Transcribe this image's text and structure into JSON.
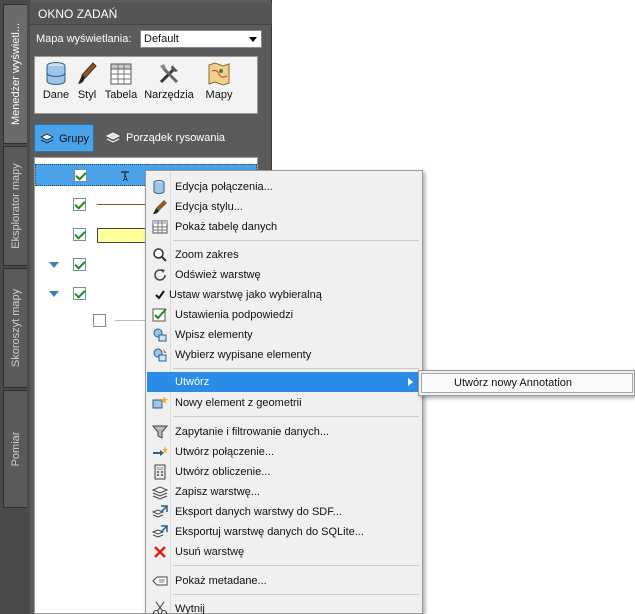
{
  "side_tabs": [
    {
      "label": "Menedżer wyświetl..."
    },
    {
      "label": "Eksplorator mapy"
    },
    {
      "label": "Skoroszyt mapy"
    },
    {
      "label": "Pomiar"
    }
  ],
  "palette": {
    "title": "OKNO ZADAŃ",
    "map_label": "Mapa wyświetlania:",
    "map_value": "Default"
  },
  "toolbar": {
    "buttons": [
      {
        "label": "Dane",
        "icon": "database-icon"
      },
      {
        "label": "Styl",
        "icon": "brush-icon"
      },
      {
        "label": "Tabela",
        "icon": "table-icon"
      },
      {
        "label": "Narzędzia",
        "icon": "tools-icon"
      },
      {
        "label": "Mapy",
        "icon": "map-icon"
      }
    ]
  },
  "view_tabs": {
    "groups": "Grupy",
    "draw_order": "Porządek rysowania"
  },
  "layers": [
    {
      "checked": true,
      "selected": true,
      "expand": false,
      "swatch": "text-style"
    },
    {
      "checked": true,
      "selected": false,
      "expand": false,
      "swatch": "line"
    },
    {
      "checked": true,
      "selected": false,
      "expand": false,
      "swatch": "yellow-fill"
    },
    {
      "checked": true,
      "selected": false,
      "expand": true,
      "swatch": "none"
    },
    {
      "checked": true,
      "selected": false,
      "expand": true,
      "swatch": "dot"
    },
    {
      "checked": false,
      "selected": false,
      "expand": false,
      "swatch": "grey-line"
    }
  ],
  "context_menu": {
    "items": [
      {
        "label": "Edycja połączenia...",
        "icon": "database-edit-icon"
      },
      {
        "label": "Edycja stylu...",
        "icon": "brush-icon"
      },
      {
        "label": "Pokaż tabelę danych",
        "icon": "table-icon"
      },
      {
        "label": "Zoom zakres",
        "icon": "zoom-icon"
      },
      {
        "label": "Odśwież warstwę",
        "icon": "refresh-icon"
      },
      {
        "label": "Ustaw warstwę jako wybieralną",
        "icon": "checkmark-icon"
      },
      {
        "label": "Ustawienia podpowiedzi",
        "icon": "tooltip-settings-icon"
      },
      {
        "label": "Wpisz elementy",
        "icon": "type-elements-icon"
      },
      {
        "label": "Wybierz wypisane elementy",
        "icon": "select-elements-icon"
      },
      {
        "label": "Utwórz",
        "icon": ""
      },
      {
        "label": "Nowy element z geometrii",
        "icon": "new-element-icon"
      },
      {
        "label": "Zapytanie i filtrowanie danych...",
        "icon": "filter-icon"
      },
      {
        "label": "Utwórz połączenie...",
        "icon": "join-icon"
      },
      {
        "label": "Utwórz obliczenie...",
        "icon": "calculator-icon"
      },
      {
        "label": "Zapisz warstwę...",
        "icon": "save-layer-icon"
      },
      {
        "label": "Eksport danych warstwy do SDF...",
        "icon": "export-sdf-icon"
      },
      {
        "label": "Eksportuj warstwę danych do SQLite...",
        "icon": "export-sqlite-icon"
      },
      {
        "label": "Usuń warstwę",
        "icon": "delete-icon"
      },
      {
        "label": "Pokaż metadane...",
        "icon": "metadata-icon"
      },
      {
        "label": "Wytnij",
        "icon": "scissors-icon"
      }
    ],
    "submenu": {
      "label": "Utwórz nowy Annotation"
    }
  },
  "colors": {
    "highlight": "#2a8ce6",
    "selection": "#4aa3e8",
    "panel": "#5b5b5b"
  }
}
